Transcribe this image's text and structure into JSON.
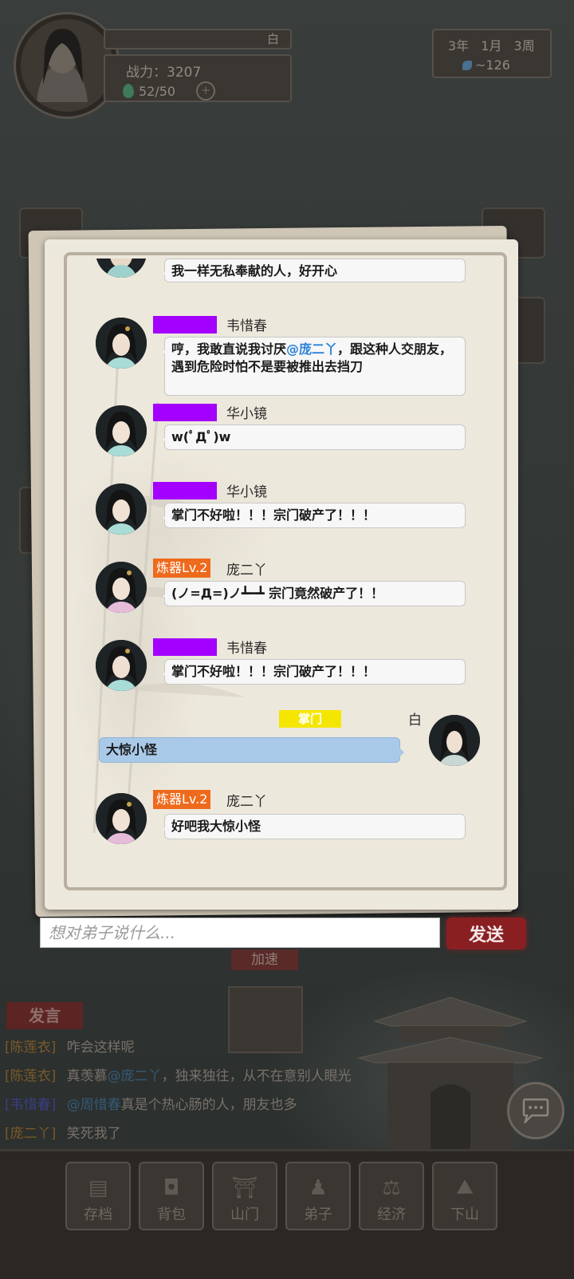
{
  "header": {
    "player_name": "白",
    "combat_power_label": "战力：3207",
    "stamina": "52/50",
    "date": "3年  1月  3周",
    "spirit_stones": "~126"
  },
  "chat": {
    "messages": [
      {
        "sender": "",
        "badge": "",
        "text": "我一样无私奉献的人，好开心",
        "partial": true
      },
      {
        "sender": "韦惜春",
        "badge": "purple",
        "text_before": "哼，我敢直说我讨厌",
        "mention": "@庞二丫",
        "text_after": "，跟这种人交朋友，遇到危险时怕不是要被推出去挡刀"
      },
      {
        "sender": "华小镜",
        "badge": "purple",
        "text": "w(ﾟДﾟ)w"
      },
      {
        "sender": "华小镜",
        "badge": "purple",
        "text": "掌门不好啦！！！宗门破产了！！！"
      },
      {
        "sender": "庞二丫",
        "badge": "炼器Lv.2",
        "text": "(ノ=Д=)ノ┻━┻ 宗门竟然破产了！！"
      },
      {
        "sender": "韦惜春",
        "badge": "purple",
        "text": "掌门不好啦！！！宗门破产了！！！"
      },
      {
        "sender": "白",
        "badge": "掌门",
        "text": "大惊小怪",
        "self": true
      },
      {
        "sender": "庞二丫",
        "badge": "炼器Lv.2",
        "text": "好吧我大惊小怪"
      }
    ],
    "input_placeholder": "想对弟子说什么...",
    "send_label": "发送"
  },
  "game": {
    "speed_label": "加速",
    "speak_tab": "发言",
    "log": [
      {
        "who": "[陈莲衣]",
        "text": "咋会这样呢"
      },
      {
        "who": "[陈莲衣]",
        "text_before": "真羡慕",
        "hl": "@庞二丫",
        "text_after": "，独来独往，从不在意别人眼光"
      },
      {
        "who": "[韦惜春]",
        "hl": "@周惜春",
        "text_after": "真是个热心肠的人，朋友也多"
      },
      {
        "who": "[庞二丫]",
        "text": "笑死我了"
      }
    ]
  },
  "nav": [
    {
      "label": "存档",
      "icon": "scroll-icon"
    },
    {
      "label": "背包",
      "icon": "bag-icon"
    },
    {
      "label": "山门",
      "icon": "gate-icon"
    },
    {
      "label": "弟子",
      "icon": "disciple-icon"
    },
    {
      "label": "经济",
      "icon": "economy-icon"
    },
    {
      "label": "下山",
      "icon": "mountain-icon"
    }
  ]
}
